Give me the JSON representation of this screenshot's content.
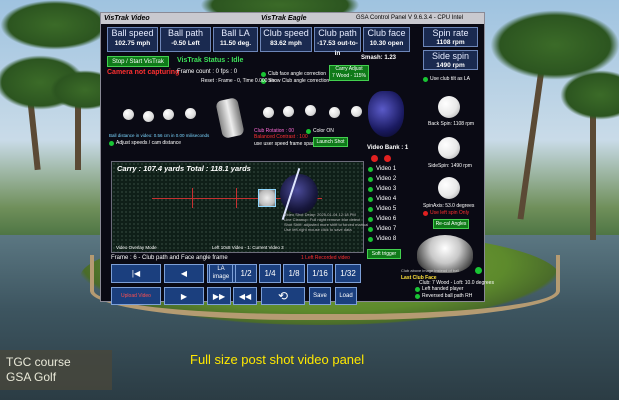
{
  "window": {
    "title_left": "VisTrak Video",
    "title_center": "VisTrak Eagle",
    "title_right": "GSA Control Panel  V 9.6.3.4 - CPU Intel"
  },
  "metrics": [
    {
      "label": "Ball speed",
      "value": "102.75 mph"
    },
    {
      "label": "Ball path",
      "value": "-0.50 Left"
    },
    {
      "label": "Ball LA",
      "value": "11.50 deg."
    },
    {
      "label": "Club speed",
      "value": "83.62 mph"
    },
    {
      "label": "Club path",
      "value": "-17.53 out-to-in"
    },
    {
      "label": "Club face",
      "value": "10.30 open"
    }
  ],
  "spin": {
    "rate_label": "Spin rate",
    "rate_value": "1108 rpm",
    "side_label": "Side spin",
    "side_value": "1490 rpm",
    "back_spin": "Back Spin: 1108 rpm",
    "side_spin": "SideSpin: 1490 rpm",
    "spin_axis": "SpinAxis: 53.0 degrees",
    "use_club_tilt": "Use club tilt as LA",
    "use_left_spin": "Use left spin Only",
    "recal_angles": "Re-cal Angles"
  },
  "controls": {
    "stop_start": "Stop / Start VisTrak",
    "camera_status": "Camera not capturing",
    "vistrak_status": "VisTrak Status : Idle",
    "frame_count": "Frame count : 0   fps : 0",
    "smash": "Smash: 1.23",
    "carry_label": "Carry Adjust",
    "carry_club": "7 Wood - 115%",
    "club_face_angle": "Club face angle correction",
    "show_club_angle": "Show Club angle correction",
    "reset_label": "Reset : Frame - 0, Time 0.000 sec",
    "ball_dist_video": "Ball distance in video: 0.56 cm  in 0.00 miliseconds",
    "adjust_speeds": "Adjust speeds / cam distance",
    "club_rotation": "Club Rotation : 00",
    "balanced_contrast": "Balanced Contrast : 100",
    "use_user_speed": "use user speed frame spacing",
    "color_on": "Color ON",
    "launch_shot": "Launch Shot",
    "video_bank": "Video Bank : 1",
    "videos": [
      "Video 1",
      "Video 2",
      "Video 3",
      "Video 4",
      "Video 5",
      "Video 6",
      "Video 7",
      "Video 8"
    ],
    "soft_trigger": "Soft trigger"
  },
  "video": {
    "carry_total": "Carry : 107.4 yards   Total : 118.1 yards",
    "info_lines": [
      "Video Shot Delay: 2025-01-04 12:18 PM",
      "Line Cleanup: Full night remove blur detect",
      "Shot Shift: adjusted more shift to forced manual"
    ],
    "save_hint": "Use left-right mouse click to save data",
    "footer_left": "Video Overlay Mode",
    "footer_mid": "Left 10x8 Video  -  1: Current Video 3",
    "frame_status": "Frame : 6 - Club path and Face angle frame",
    "left_recorded": "1 Left Recorded video"
  },
  "playback": {
    "la_image_label": "LA image",
    "fractions": [
      "1/2",
      "1/4",
      "1/8",
      "1/16",
      "1/32"
    ],
    "upload_label": "Upload Video",
    "save_label": "Save",
    "load_label": "Load",
    "loop_icon": "loop-icon"
  },
  "club": {
    "name": "Club: 7 Wood - Loft: 10.0 degrees",
    "left_handed": "Left handed player",
    "reversed_path": "Reversed ball path RH",
    "last_club_face": "Last Club Face",
    "ball_note": "Club above image instead of ball"
  },
  "footer": {
    "tag_line1": "TGC course",
    "tag_line2": "GSA Golf",
    "caption": "Full size post shot video panel"
  },
  "colors": {
    "metric_bg": "#1a2a50",
    "green_button": "#0f7a19",
    "caption_yellow": "#ffe800",
    "status_red": "#ff3030"
  }
}
